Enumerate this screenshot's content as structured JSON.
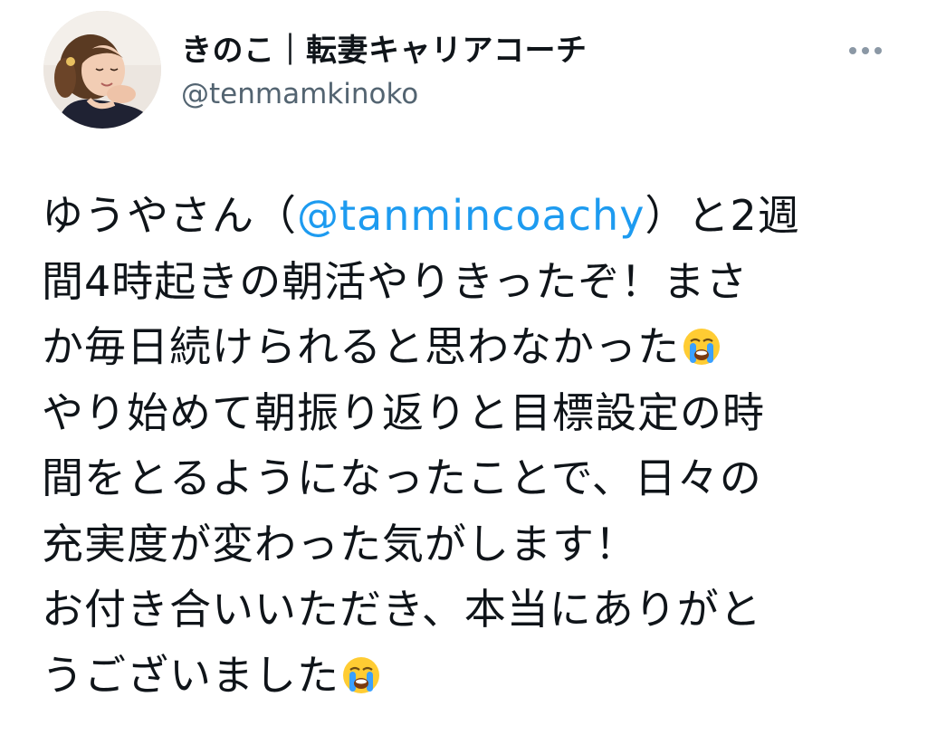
{
  "author": {
    "display_name": "きのこ｜転妻キャリアコーチ",
    "handle": "@tenmamkinoko",
    "avatar_icon": "profile-photo"
  },
  "more_icon": "more-horizontal-icon",
  "tweet": {
    "line1_before": "ゆうやさん（",
    "mention": "@tanmincoachy",
    "line1_after": "）と2週",
    "line2": "間4時起きの朝活やりきったぞ！まさ",
    "line3": "か毎日続けられると思わなかった",
    "line4": "やり始めて朝振り返りと目標設定の時",
    "line5": "間をとるようになったことで、日々の",
    "line6": "充実度が変わった気がします！",
    "line7": "お付き合いいただき、本当にありがと",
    "line8": "うございました",
    "emoji": "loudly-crying-face"
  },
  "colors": {
    "text": "#0f1419",
    "secondary": "#536471",
    "link": "#1d9bf0"
  }
}
